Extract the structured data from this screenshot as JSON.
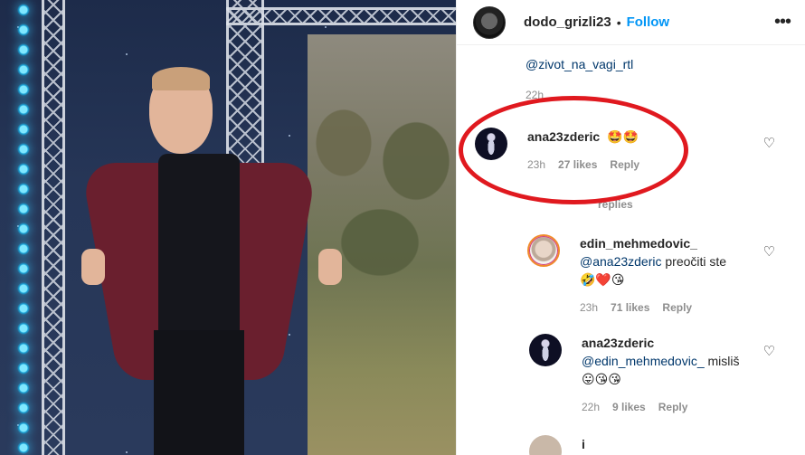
{
  "post": {
    "owner": "dodo_grizli23",
    "separator": "•",
    "follow_label": "Follow",
    "more_icon": "more-horizontal-icon"
  },
  "comments": {
    "partial_top": {
      "mention": "@zivot_na_vagi_rtl",
      "time": "22h"
    },
    "ana_1": {
      "user": "ana23zderic",
      "text": "🤩🤩",
      "time": "23h",
      "likes": "27 likes",
      "reply": "Reply"
    },
    "view_replies": "replies",
    "edin": {
      "user": "edin_mehmedovic_",
      "mention": "@ana23zderic",
      "text": "preočiti ste 🤣❤️😘",
      "time": "23h",
      "likes": "71 likes",
      "reply": "Reply"
    },
    "ana_2": {
      "user": "ana23zderic",
      "mention": "@edin_mehmedovic_",
      "text": "misliš 😛😘😘",
      "time": "22h",
      "likes": "9 likes",
      "reply": "Reply"
    },
    "partial_bottom": "i"
  },
  "annotation_color": "#e0191f",
  "accent_color": "#0095f6"
}
